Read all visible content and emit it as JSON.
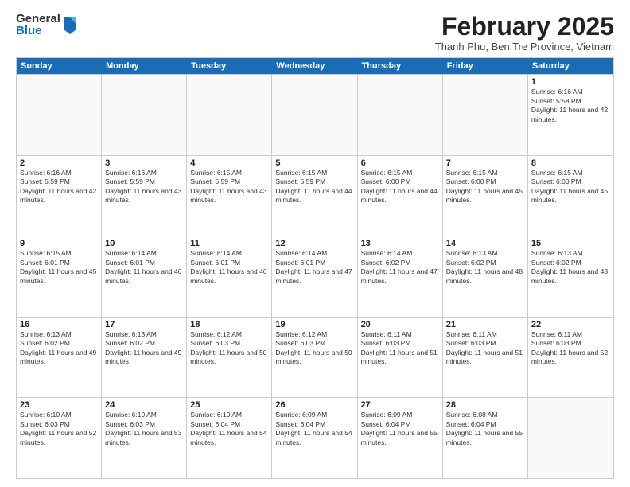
{
  "header": {
    "logo": {
      "general": "General",
      "blue": "Blue"
    },
    "title": "February 2025",
    "location": "Thanh Phu, Ben Tre Province, Vietnam"
  },
  "days_of_week": [
    "Sunday",
    "Monday",
    "Tuesday",
    "Wednesday",
    "Thursday",
    "Friday",
    "Saturday"
  ],
  "weeks": [
    [
      {
        "day": "",
        "info": ""
      },
      {
        "day": "",
        "info": ""
      },
      {
        "day": "",
        "info": ""
      },
      {
        "day": "",
        "info": ""
      },
      {
        "day": "",
        "info": ""
      },
      {
        "day": "",
        "info": ""
      },
      {
        "day": "1",
        "info": "Sunrise: 6:16 AM\nSunset: 5:58 PM\nDaylight: 11 hours and 42 minutes."
      }
    ],
    [
      {
        "day": "2",
        "info": "Sunrise: 6:16 AM\nSunset: 5:59 PM\nDaylight: 11 hours and 42 minutes."
      },
      {
        "day": "3",
        "info": "Sunrise: 6:16 AM\nSunset: 5:59 PM\nDaylight: 11 hours and 43 minutes."
      },
      {
        "day": "4",
        "info": "Sunrise: 6:15 AM\nSunset: 5:59 PM\nDaylight: 11 hours and 43 minutes."
      },
      {
        "day": "5",
        "info": "Sunrise: 6:15 AM\nSunset: 5:59 PM\nDaylight: 11 hours and 44 minutes."
      },
      {
        "day": "6",
        "info": "Sunrise: 6:15 AM\nSunset: 6:00 PM\nDaylight: 11 hours and 44 minutes."
      },
      {
        "day": "7",
        "info": "Sunrise: 6:15 AM\nSunset: 6:00 PM\nDaylight: 11 hours and 45 minutes."
      },
      {
        "day": "8",
        "info": "Sunrise: 6:15 AM\nSunset: 6:00 PM\nDaylight: 11 hours and 45 minutes."
      }
    ],
    [
      {
        "day": "9",
        "info": "Sunrise: 6:15 AM\nSunset: 6:01 PM\nDaylight: 11 hours and 45 minutes."
      },
      {
        "day": "10",
        "info": "Sunrise: 6:14 AM\nSunset: 6:01 PM\nDaylight: 11 hours and 46 minutes."
      },
      {
        "day": "11",
        "info": "Sunrise: 6:14 AM\nSunset: 6:01 PM\nDaylight: 11 hours and 46 minutes."
      },
      {
        "day": "12",
        "info": "Sunrise: 6:14 AM\nSunset: 6:01 PM\nDaylight: 11 hours and 47 minutes."
      },
      {
        "day": "13",
        "info": "Sunrise: 6:14 AM\nSunset: 6:02 PM\nDaylight: 11 hours and 47 minutes."
      },
      {
        "day": "14",
        "info": "Sunrise: 6:13 AM\nSunset: 6:02 PM\nDaylight: 11 hours and 48 minutes."
      },
      {
        "day": "15",
        "info": "Sunrise: 6:13 AM\nSunset: 6:02 PM\nDaylight: 11 hours and 48 minutes."
      }
    ],
    [
      {
        "day": "16",
        "info": "Sunrise: 6:13 AM\nSunset: 6:02 PM\nDaylight: 11 hours and 49 minutes."
      },
      {
        "day": "17",
        "info": "Sunrise: 6:13 AM\nSunset: 6:02 PM\nDaylight: 11 hours and 49 minutes."
      },
      {
        "day": "18",
        "info": "Sunrise: 6:12 AM\nSunset: 6:03 PM\nDaylight: 11 hours and 50 minutes."
      },
      {
        "day": "19",
        "info": "Sunrise: 6:12 AM\nSunset: 6:03 PM\nDaylight: 11 hours and 50 minutes."
      },
      {
        "day": "20",
        "info": "Sunrise: 6:11 AM\nSunset: 6:03 PM\nDaylight: 11 hours and 51 minutes."
      },
      {
        "day": "21",
        "info": "Sunrise: 6:11 AM\nSunset: 6:03 PM\nDaylight: 11 hours and 51 minutes."
      },
      {
        "day": "22",
        "info": "Sunrise: 6:11 AM\nSunset: 6:03 PM\nDaylight: 11 hours and 52 minutes."
      }
    ],
    [
      {
        "day": "23",
        "info": "Sunrise: 6:10 AM\nSunset: 6:03 PM\nDaylight: 11 hours and 52 minutes."
      },
      {
        "day": "24",
        "info": "Sunrise: 6:10 AM\nSunset: 6:03 PM\nDaylight: 11 hours and 53 minutes."
      },
      {
        "day": "25",
        "info": "Sunrise: 6:10 AM\nSunset: 6:04 PM\nDaylight: 11 hours and 54 minutes."
      },
      {
        "day": "26",
        "info": "Sunrise: 6:09 AM\nSunset: 6:04 PM\nDaylight: 11 hours and 54 minutes."
      },
      {
        "day": "27",
        "info": "Sunrise: 6:09 AM\nSunset: 6:04 PM\nDaylight: 11 hours and 55 minutes."
      },
      {
        "day": "28",
        "info": "Sunrise: 6:08 AM\nSunset: 6:04 PM\nDaylight: 11 hours and 55 minutes."
      },
      {
        "day": "",
        "info": ""
      }
    ]
  ]
}
